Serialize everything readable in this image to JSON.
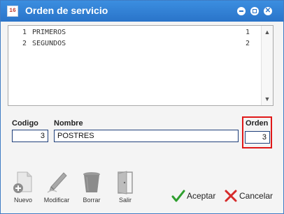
{
  "window": {
    "title": "Orden de servicio",
    "app_icon_text": "16"
  },
  "titlebar_buttons": {
    "minimize_icon": "minimize-icon",
    "maximize_icon": "maximize-icon",
    "close_icon": "close-icon",
    "close_glyph": "✕"
  },
  "list": {
    "rows": [
      {
        "index": "1",
        "name": "PRIMEROS",
        "order": "1"
      },
      {
        "index": "2",
        "name": "SEGUNDOS",
        "order": "2"
      }
    ],
    "scroll_up_glyph": "▲",
    "scroll_down_glyph": "▼"
  },
  "form": {
    "codigo_label": "Codigo",
    "codigo_value": "3",
    "nombre_label": "Nombre",
    "nombre_value": "POSTRES",
    "orden_label": "Orden",
    "orden_value": "3"
  },
  "toolbar": {
    "nuevo_label": "Nuevo",
    "modificar_label": "Modificar",
    "borrar_label": "Borrar",
    "salir_label": "Salir"
  },
  "actions": {
    "aceptar_label": "Aceptar",
    "cancelar_label": "Cancelar"
  },
  "colors": {
    "titlebar": "#2a74c9",
    "field_border": "#1f3f7a",
    "highlight": "#e01818",
    "accept_green": "#2e9e2e",
    "cancel_red": "#d62a2a"
  }
}
